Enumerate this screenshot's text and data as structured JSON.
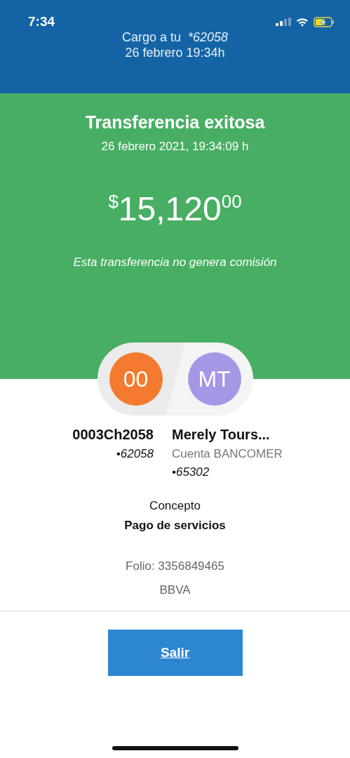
{
  "status_bar": {
    "time": "7:34"
  },
  "header": {
    "line1": "Cargo a tu",
    "account": "*62058",
    "line2": "26 febrero 19:34h"
  },
  "result": {
    "title": "Transferencia exitosa",
    "datetime": "26 febrero 2021, 19:34:09 h",
    "currency": "$",
    "amount": "15,120",
    "cents": "00",
    "note": "Esta transferencia no genera comisión"
  },
  "parties": [
    {
      "initials": "00",
      "color": "#f37a2e",
      "name": "0003Ch2058",
      "lines": [
        "•62058"
      ]
    },
    {
      "initials": "MT",
      "color": "#a596e6",
      "name": "Merely Tours...",
      "bank": "Cuenta BANCOMER",
      "lines": [
        "•65302"
      ]
    }
  ],
  "concept": {
    "label": "Concepto",
    "value": "Pago de servicios"
  },
  "folio": "Folio: 3356849465",
  "bank": "BBVA",
  "button": "Salir"
}
